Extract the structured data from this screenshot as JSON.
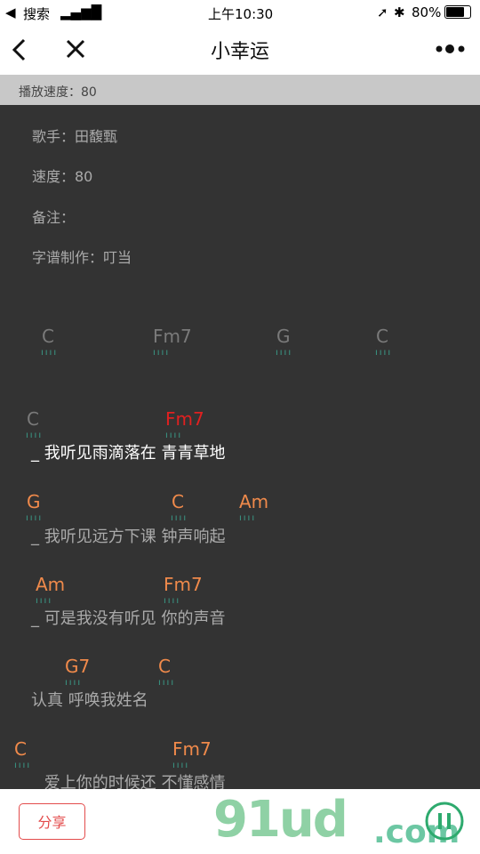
{
  "status": {
    "back_app": "搜索",
    "time": "上午10:30",
    "battery": "80%"
  },
  "nav": {
    "title": "小幸运"
  },
  "speed_bar": {
    "label": "播放速度：80"
  },
  "meta": {
    "singer": "歌手：田馥甄",
    "speed": "速度：80",
    "note": "备注：",
    "author": "字谱制作：叮当"
  },
  "intro": [
    "C",
    "Fm7",
    "G",
    "C"
  ],
  "lines": [
    {
      "chords": [
        "C",
        "Fm7"
      ],
      "lyric": "_ 我听见雨滴落在 青青草地"
    },
    {
      "chords": [
        "G",
        "C",
        "Am"
      ],
      "lyric": "_ 我听见远方下课 钟声响起"
    },
    {
      "chords": [
        "Am",
        "Fm7"
      ],
      "lyric": "_ 可是我没有听见 你的声音"
    },
    {
      "chords": [
        "G7",
        "C"
      ],
      "lyric": "认真 呼唤我姓名"
    },
    {
      "chords": [
        "C",
        "Fm7"
      ],
      "lyric": "_ 爱上你的时候还 不懂感情"
    }
  ],
  "ticks": "ıııı",
  "bottom": {
    "share_label": "分享",
    "watermark": "91ud",
    "watermark_domain": ".com"
  },
  "colors": {
    "chord": "#f08a4b",
    "chord_active": "#e02020",
    "chord_dim": "#7a7a7a",
    "tick": "#3a9e8a"
  }
}
